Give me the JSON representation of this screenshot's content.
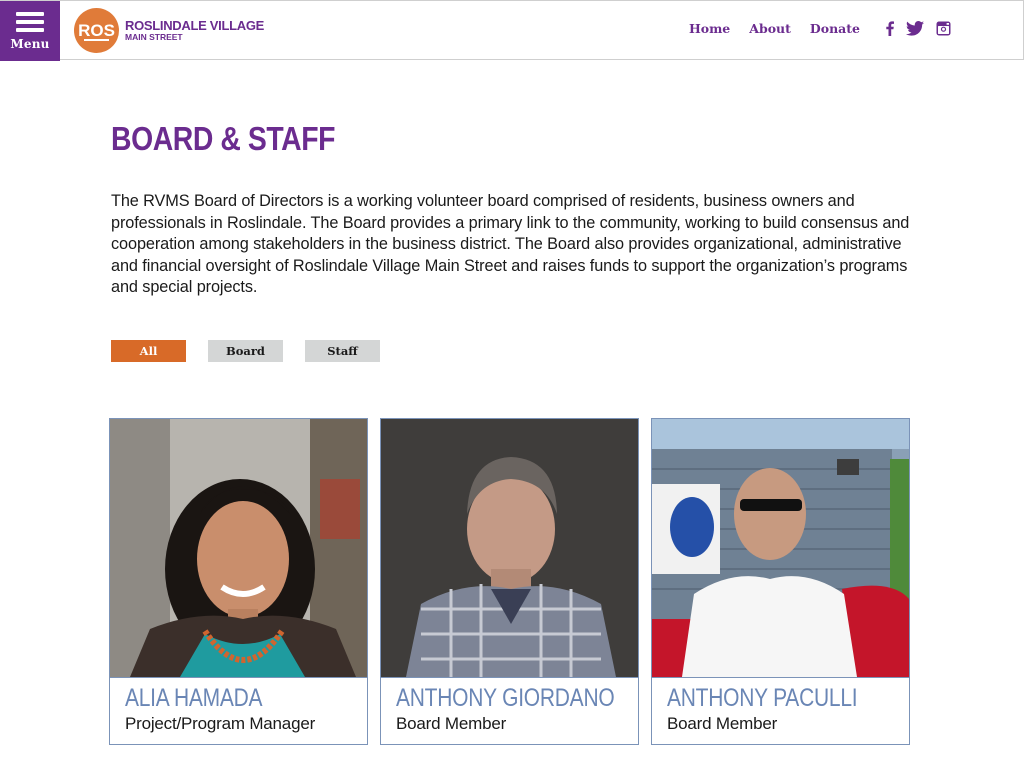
{
  "header": {
    "menu_label": "Menu",
    "logo_mark": "ROS",
    "logo_line1": "ROSLINDALE VILLAGE",
    "logo_line2": "MAIN STREET",
    "nav": [
      {
        "label": "Home"
      },
      {
        "label": "About"
      },
      {
        "label": "Donate"
      }
    ],
    "social_icons": [
      "facebook-icon",
      "twitter-icon",
      "instagram-icon"
    ]
  },
  "main": {
    "title": "BOARD & STAFF",
    "intro": "The RVMS Board of Directors is a working volunteer board comprised of residents, business owners and professionals in Roslindale. The Board provides a primary link to the community, working to build consensus and cooperation among stakeholders in the business district. The Board also provides organizational, administrative and financial oversight of Roslindale Village Main Street and raises funds to support the organization’s programs and special projects.",
    "filters": [
      {
        "label": "All",
        "active": true
      },
      {
        "label": "Board",
        "active": false
      },
      {
        "label": "Staff",
        "active": false
      }
    ],
    "members": [
      {
        "name": "ALIA HAMADA",
        "role": "Project/Program Manager"
      },
      {
        "name": "ANTHONY GIORDANO",
        "role": "Board Member"
      },
      {
        "name": "ANTHONY PACULLI",
        "role": "Board Member"
      }
    ]
  },
  "colors": {
    "brand_purple": "#6b2c8f",
    "brand_orange": "#e07b39",
    "active_filter": "#d86a28",
    "card_name": "#6a86b5"
  }
}
